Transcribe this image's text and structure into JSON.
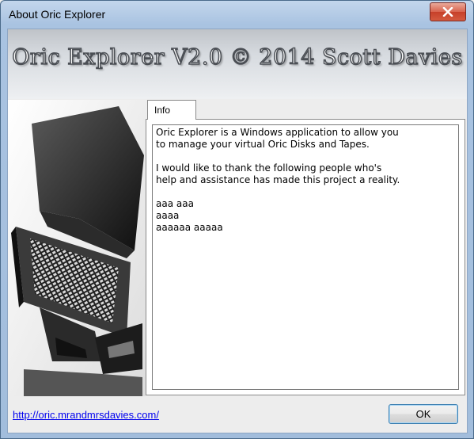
{
  "window": {
    "title": "About Oric Explorer"
  },
  "banner": {
    "title": "Oric Explorer V2.0 © 2014 Scott Davies"
  },
  "tabs": [
    {
      "label": "Info"
    }
  ],
  "info": {
    "para1_line1": "Oric Explorer is a Windows application to allow you",
    "para1_line2": "to manage your virtual Oric Disks and Tapes.",
    "para2_line1": "I would like to thank the following people who's",
    "para2_line2": "help and assistance has made this project a reality.",
    "names": [
      "aaa aaa",
      "aaaa",
      "aaaaaa aaaaa"
    ]
  },
  "footer": {
    "link_text": "http://oric.mrandmrsdavies.com/",
    "ok_label": "OK"
  },
  "icons": {
    "close": "close-icon"
  }
}
